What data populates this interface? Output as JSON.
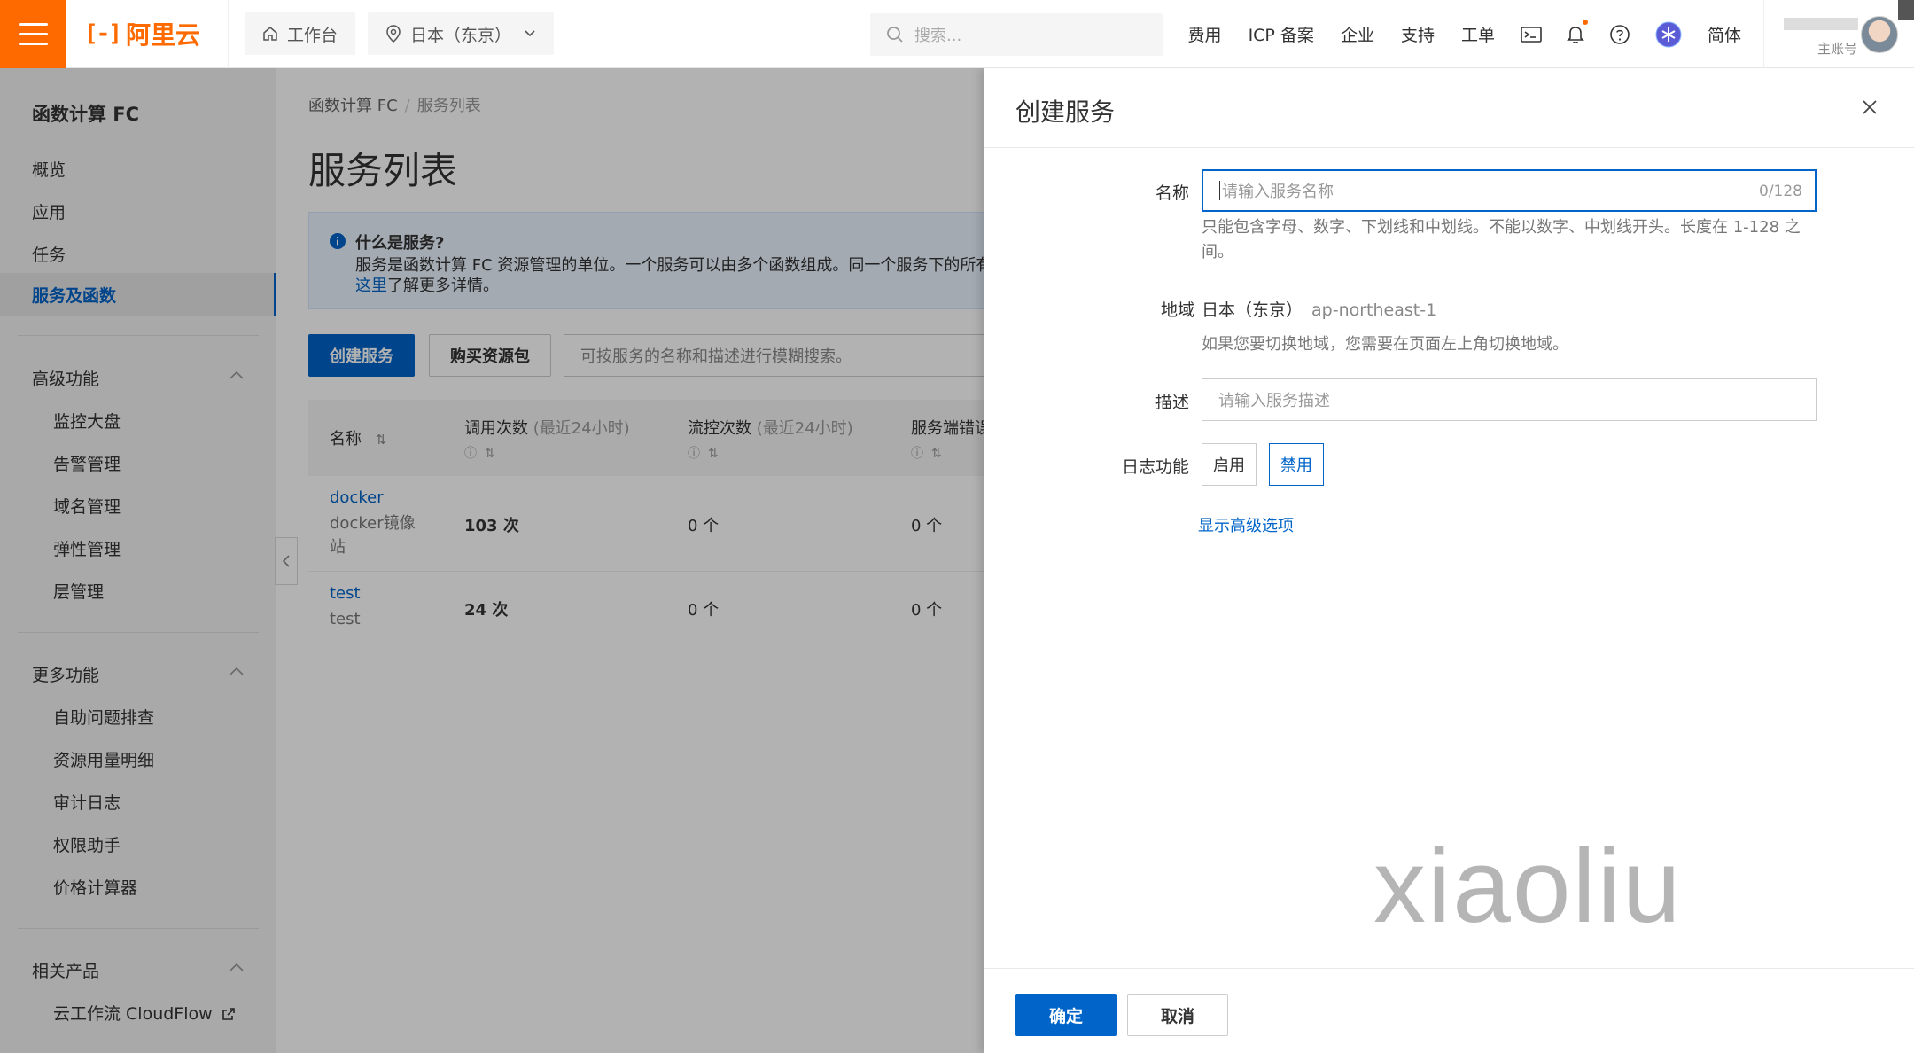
{
  "topbar": {
    "logo_text": "阿里云",
    "workbench": "工作台",
    "region": "日本（东京）",
    "search_placeholder": "搜索...",
    "links": [
      "费用",
      "ICP 备案",
      "企业",
      "支持",
      "工单"
    ],
    "lang": "简体",
    "account_sub": "主账号"
  },
  "sidebar": {
    "title": "函数计算 FC",
    "items": [
      "概览",
      "应用",
      "任务",
      "服务及函数"
    ],
    "sections": [
      {
        "title": "高级功能",
        "items": [
          "监控大盘",
          "告警管理",
          "域名管理",
          "弹性管理",
          "层管理"
        ]
      },
      {
        "title": "更多功能",
        "items": [
          "自助问题排查",
          "资源用量明细",
          "审计日志",
          "权限助手",
          "价格计算器"
        ]
      },
      {
        "title": "相关产品",
        "items": [
          "云工作流 CloudFlow"
        ]
      }
    ]
  },
  "main": {
    "breadcrumb": [
      "函数计算 FC",
      "服务列表"
    ],
    "title": "服务列表",
    "info": {
      "heading": "什么是服务?",
      "body": "服务是函数计算 FC 资源管理的单位。一个服务可以由多个函数组成。同一个服务下的所有",
      "link": "这里",
      "tail": "了解更多详情。"
    },
    "create_button": "创建服务",
    "buy_button": "购买资源包",
    "filter_placeholder": "可按服务的名称和描述进行模糊搜索。",
    "columns": [
      {
        "label": "名称",
        "note": ""
      },
      {
        "label": "调用次数",
        "note": "(最近24小时)"
      },
      {
        "label": "流控次数",
        "note": "(最近24小时)"
      },
      {
        "label": "服务端错误",
        "note": ""
      }
    ],
    "rows": [
      {
        "name": "docker",
        "desc": "docker镜像站",
        "calls": "103 次",
        "throttles": "0 个",
        "errors": "0 个"
      },
      {
        "name": "test",
        "desc": "test",
        "calls": "24 次",
        "throttles": "0 个",
        "errors": "0 个"
      }
    ]
  },
  "drawer": {
    "title": "创建服务",
    "name_label": "名称",
    "name_placeholder": "请输入服务名称",
    "name_count": "0/128",
    "name_hint": "只能包含字母、数字、下划线和中划线。不能以数字、中划线开头。长度在 1-128 之间。",
    "region_label": "地域",
    "region_value": "日本（东京）",
    "region_code": "ap-northeast-1",
    "region_hint": "如果您要切换地域，您需要在页面左上角切换地域。",
    "desc_label": "描述",
    "desc_placeholder": "请输入服务描述",
    "log_label": "日志功能",
    "log_enable": "启用",
    "log_disable": "禁用",
    "advanced": "显示高级选项",
    "watermark": "xiaoliu",
    "ok": "确定",
    "cancel": "取消"
  }
}
